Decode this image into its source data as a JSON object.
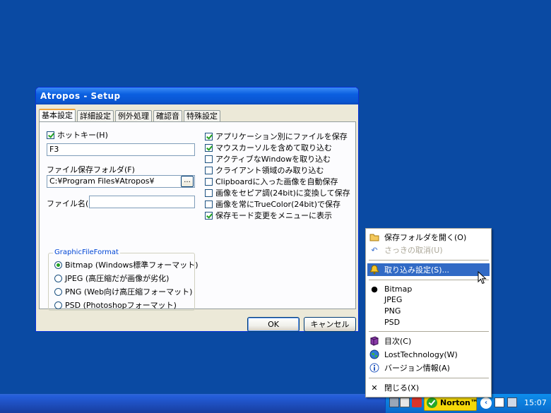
{
  "window": {
    "title": "Atropos - Setup",
    "tabs": [
      "基本設定",
      "詳細設定",
      "例外処理",
      "確認音",
      "特殊設定"
    ],
    "hotkey_label": "ホットキー(H)",
    "hotkey_value": "F3",
    "folder_label": "ファイル保存フォルダ(F)",
    "folder_value": "C:¥Program Files¥Atropos¥",
    "browse_label": "...",
    "filename_label": "ファイル名(N)",
    "filename_value": "",
    "group_title": "GraphicFileFormat",
    "formats": [
      {
        "label": "Bitmap (Windows標準フォーマット)",
        "checked": true
      },
      {
        "label": "JPEG (高圧縮だが画像が劣化)",
        "checked": false
      },
      {
        "label": "PNG (Web向け高圧縮フォーマット)",
        "checked": false
      },
      {
        "label": "PSD (Photoshopフォーマット)",
        "checked": false
      }
    ],
    "options": [
      {
        "label": "アプリケーション別にファイルを保存",
        "checked": true
      },
      {
        "label": "マウスカーソルを含めて取り込む",
        "checked": true
      },
      {
        "label": "アクティブなWindowを取り込む",
        "checked": false
      },
      {
        "label": "クライアント領域のみ取り込む",
        "checked": false
      },
      {
        "label": "Clipboardに入った画像を自動保存",
        "checked": false
      },
      {
        "label": "画像をセピア調(24bit)に変換して保存",
        "checked": false
      },
      {
        "label": "画像を常にTrueColor(24bit)で保存",
        "checked": false
      },
      {
        "label": "保存モード変更をメニューに表示",
        "checked": true
      }
    ],
    "ok_label": "OK",
    "cancel_label": "キャンセル"
  },
  "menu": {
    "items": [
      {
        "label": "保存フォルダを開く(O)",
        "icon": "folder-icon"
      },
      {
        "label": "さっきの取消(U)",
        "icon": "undo-icon",
        "disabled": true
      },
      {
        "label": "取り込み設定(S)...",
        "icon": "bell-icon",
        "highlighted": true
      },
      {
        "label": "Bitmap",
        "icon": "bullet-icon",
        "selected": true
      },
      {
        "label": "JPEG"
      },
      {
        "label": "PNG"
      },
      {
        "label": "PSD"
      },
      {
        "label": "目次(C)",
        "icon": "book-icon"
      },
      {
        "label": "LostTechnology(W)",
        "icon": "globe-icon"
      },
      {
        "label": "バージョン情報(A)",
        "icon": "info-icon"
      },
      {
        "label": "閉じる(X)",
        "icon": "close-icon"
      }
    ]
  },
  "taskbar": {
    "norton_label": "Norton™",
    "clock": "15:07"
  },
  "colors": {
    "desktop": "#0a4aa3",
    "highlight": "#316ac5",
    "norton": "#f5d90a"
  }
}
